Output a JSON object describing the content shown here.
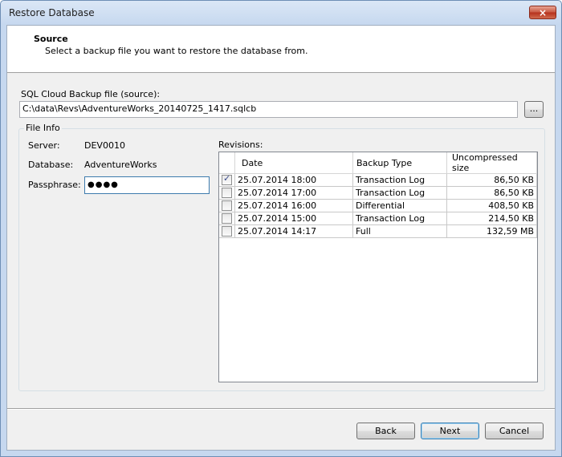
{
  "window": {
    "title": "Restore Database",
    "close_icon": "×"
  },
  "header": {
    "title": "Source",
    "subtitle": "Select a backup file you want to restore the database from."
  },
  "source": {
    "label": "SQL Cloud Backup file (source):",
    "path": "C:\\data\\Revs\\AdventureWorks_20140725_1417.sqlcb",
    "browse_label": "..."
  },
  "file_info": {
    "group_label": "File Info",
    "server_label": "Server:",
    "server_value": "DEV0010",
    "database_label": "Database:",
    "database_value": "AdventureWorks",
    "passphrase_label": "Passphrase:",
    "passphrase_value": "●●●●"
  },
  "revisions": {
    "label": "Revisions:",
    "columns": [
      "",
      "Date",
      "Backup Type",
      "Uncompressed size"
    ],
    "rows": [
      {
        "checked": true,
        "date": "25.07.2014 18:00",
        "type": "Transaction Log",
        "size": "86,50 KB"
      },
      {
        "checked": false,
        "date": "25.07.2014 17:00",
        "type": "Transaction Log",
        "size": "86,50 KB"
      },
      {
        "checked": false,
        "date": "25.07.2014 16:00",
        "type": "Differential",
        "size": "408,50 KB"
      },
      {
        "checked": false,
        "date": "25.07.2014 15:00",
        "type": "Transaction Log",
        "size": "214,50 KB"
      },
      {
        "checked": false,
        "date": "25.07.2014 14:17",
        "type": "Full",
        "size": "132,59 MB"
      }
    ]
  },
  "buttons": {
    "back": "Back",
    "next": "Next",
    "cancel": "Cancel"
  }
}
